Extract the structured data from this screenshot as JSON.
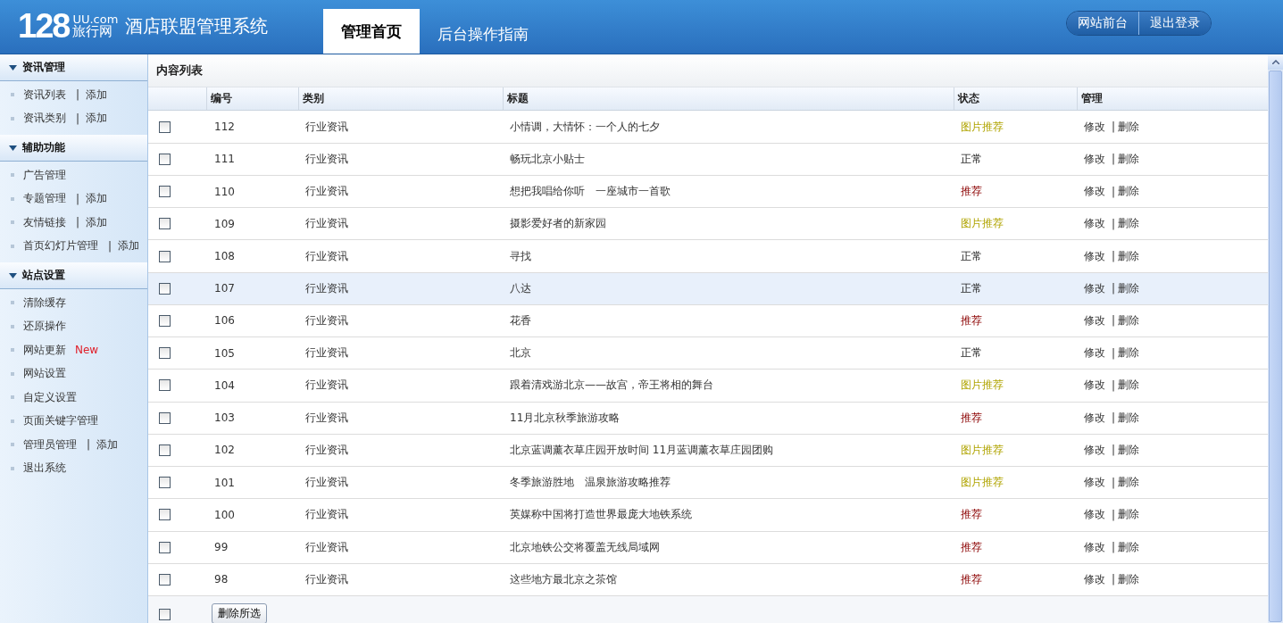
{
  "header": {
    "logo": {
      "number": "128",
      "domain": "UU.com",
      "brand": "旅行网"
    },
    "system_title": "酒店联盟管理系统",
    "tabs": [
      {
        "label": "管理首页",
        "selected": true
      },
      {
        "label": "后台操作指南",
        "selected": false
      }
    ],
    "buttons": [
      "网站前台",
      "退出登录"
    ]
  },
  "sidebar": {
    "sections": [
      {
        "title": "资讯管理",
        "expanded": true,
        "items": [
          {
            "label": "资讯列表",
            "sep": "|",
            "add": "添加"
          },
          {
            "label": "资讯类别",
            "sep": "|",
            "add": "添加"
          }
        ]
      },
      {
        "title": "辅助功能",
        "expanded": true,
        "items": [
          {
            "label": "广告管理"
          },
          {
            "label": "专题管理",
            "sep": "|",
            "add": "添加"
          },
          {
            "label": "友情链接",
            "sep": "|",
            "add": "添加"
          },
          {
            "label": "首页幻灯片管理",
            "sep": "|",
            "add": "添加"
          }
        ]
      },
      {
        "title": "站点设置",
        "expanded": true,
        "items": [
          {
            "label": "清除缓存"
          },
          {
            "label": "还原操作"
          },
          {
            "label": "网站更新",
            "badge": "New"
          },
          {
            "label": "网站设置"
          },
          {
            "label": "自定义设置"
          },
          {
            "label": "页面关键字管理"
          },
          {
            "label": "管理员管理",
            "sep": "|",
            "add": "添加"
          },
          {
            "label": "退出系统"
          }
        ]
      }
    ]
  },
  "content": {
    "title": "内容列表",
    "table": {
      "columns": [
        "编号",
        "类别",
        "标题",
        "状态",
        "管理"
      ],
      "rows": [
        {
          "checked": false,
          "selected": false,
          "id": "112",
          "category": "行业资讯",
          "title": "小情调，大情怀：一个人的七夕",
          "status": {
            "text": "图片推荐",
            "kind": "picture"
          },
          "actions": [
            "修改",
            "|",
            "删除"
          ]
        },
        {
          "checked": false,
          "selected": false,
          "id": "111",
          "category": "行业资讯",
          "title": "畅玩北京小贴士",
          "status": {
            "text": "正常",
            "kind": "normal"
          },
          "actions": [
            "修改",
            "|",
            "删除"
          ]
        },
        {
          "checked": false,
          "selected": false,
          "id": "110",
          "category": "行业资讯",
          "title": "想把我唱给你听　一座城市一首歌",
          "status": {
            "text": "推荐",
            "kind": "featured"
          },
          "actions": [
            "修改",
            "|",
            "删除"
          ]
        },
        {
          "checked": false,
          "selected": false,
          "id": "109",
          "category": "行业资讯",
          "title": "摄影爱好者的新家园",
          "status": {
            "text": "图片推荐",
            "kind": "picture"
          },
          "actions": [
            "修改",
            "|",
            "删除"
          ]
        },
        {
          "checked": false,
          "selected": false,
          "id": "108",
          "category": "行业资讯",
          "title": "寻找",
          "status": {
            "text": "正常",
            "kind": "normal"
          },
          "actions": [
            "修改",
            "|",
            "删除"
          ]
        },
        {
          "checked": false,
          "selected": true,
          "id": "107",
          "category": "行业资讯",
          "title": "八达",
          "status": {
            "text": "正常",
            "kind": "normal"
          },
          "actions": [
            "修改",
            "|",
            "删除"
          ]
        },
        {
          "checked": false,
          "selected": false,
          "id": "106",
          "category": "行业资讯",
          "title": "花香",
          "status": {
            "text": "推荐",
            "kind": "featured"
          },
          "actions": [
            "修改",
            "|",
            "删除"
          ]
        },
        {
          "checked": false,
          "selected": false,
          "id": "105",
          "category": "行业资讯",
          "title": "北京",
          "status": {
            "text": "正常",
            "kind": "normal"
          },
          "actions": [
            "修改",
            "|",
            "删除"
          ]
        },
        {
          "checked": false,
          "selected": false,
          "id": "104",
          "category": "行业资讯",
          "title": "跟着清戏游北京——故宫，帝王将相的舞台",
          "status": {
            "text": "图片推荐",
            "kind": "picture"
          },
          "actions": [
            "修改",
            "|",
            "删除"
          ]
        },
        {
          "checked": false,
          "selected": false,
          "id": "103",
          "category": "行业资讯",
          "title": "11月北京秋季旅游攻略",
          "status": {
            "text": "推荐",
            "kind": "featured"
          },
          "actions": [
            "修改",
            "|",
            "删除"
          ]
        },
        {
          "checked": false,
          "selected": false,
          "id": "102",
          "category": "行业资讯",
          "title": "北京蓝调薰衣草庄园开放时间 11月蓝调薰衣草庄园团购",
          "status": {
            "text": "图片推荐",
            "kind": "picture"
          },
          "actions": [
            "修改",
            "|",
            "删除"
          ]
        },
        {
          "checked": false,
          "selected": false,
          "id": "101",
          "category": "行业资讯",
          "title": "冬季旅游胜地　温泉旅游攻略推荐",
          "status": {
            "text": "图片推荐",
            "kind": "picture"
          },
          "actions": [
            "修改",
            "|",
            "删除"
          ]
        },
        {
          "checked": false,
          "selected": false,
          "id": "100",
          "category": "行业资讯",
          "title": "英媒称中国将打造世界最庞大地铁系统",
          "status": {
            "text": "推荐",
            "kind": "featured"
          },
          "actions": [
            "修改",
            "|",
            "删除"
          ]
        },
        {
          "checked": false,
          "selected": false,
          "id": "99",
          "category": "行业资讯",
          "title": "北京地铁公交将覆盖无线局域网",
          "status": {
            "text": "推荐",
            "kind": "featured"
          },
          "actions": [
            "修改",
            "|",
            "删除"
          ]
        },
        {
          "checked": false,
          "selected": false,
          "id": "98",
          "category": "行业资讯",
          "title": "这些地方最北京之茶馆",
          "status": {
            "text": "推荐",
            "kind": "featured"
          },
          "actions": [
            "修改",
            "|",
            "删除"
          ]
        }
      ],
      "footer": {
        "select_all_checked": false,
        "button": "删除所选"
      }
    }
  }
}
